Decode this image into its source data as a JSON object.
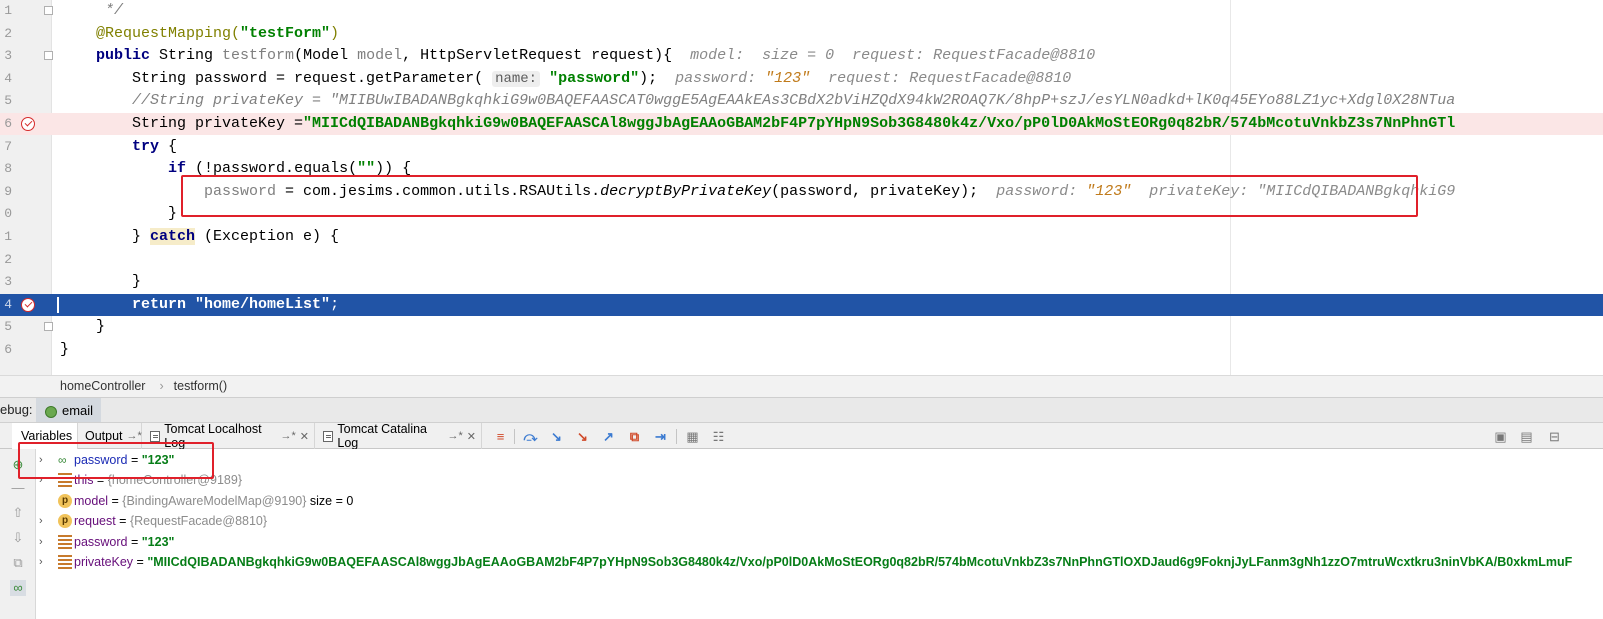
{
  "editor": {
    "lines": [
      {
        "n": "1",
        "parts": [
          {
            "t": "     */",
            "c": "cmt"
          }
        ]
      },
      {
        "n": "2",
        "parts": [
          {
            "t": "    @RequestMapping(",
            "c": "ann"
          },
          {
            "t": "\"testForm\"",
            "c": "str"
          },
          {
            "t": ")",
            "c": "ann"
          }
        ]
      },
      {
        "n": "3",
        "parts": [
          {
            "t": "    ",
            "c": ""
          },
          {
            "t": "public ",
            "c": "kw"
          },
          {
            "t": "String ",
            "c": ""
          },
          {
            "t": "testform",
            "c": "dim"
          },
          {
            "t": "(Model ",
            "c": ""
          },
          {
            "t": "model",
            "c": "dim"
          },
          {
            "t": ", HttpServletRequest request){  ",
            "c": ""
          },
          {
            "t": "model:  size = 0  request: RequestFacade@8810",
            "c": "hint"
          }
        ]
      },
      {
        "n": "4",
        "parts": [
          {
            "t": "        String password = request.getParameter( ",
            "c": ""
          },
          {
            "t": "name:",
            "c": "chip"
          },
          {
            "t": " ",
            "c": ""
          },
          {
            "t": "\"password\"",
            "c": "str"
          },
          {
            "t": ");  ",
            "c": ""
          },
          {
            "t": "password: ",
            "c": "hint"
          },
          {
            "t": "\"123\"",
            "c": "hstr"
          },
          {
            "t": "  request: RequestFacade@8810",
            "c": "hint"
          }
        ]
      },
      {
        "n": "5",
        "parts": [
          {
            "t": "        //String privateKey = \"MIIBUwIBADANBgkqhkiG9w0BAQEFAASCAT0wggE5AgEAAkEAs3CBdX2bViHZQdX94kW2ROAQ7K/8hpP+szJ/esYLN0adkd+lK0q45EYo88LZ1yc+Xdgl0X28NTua",
            "c": "cmt"
          }
        ]
      },
      {
        "n": "6",
        "parts": [
          {
            "t": "        String privateKey =",
            "c": ""
          },
          {
            "t": "\"MIICdQIBADANBgkqhkiG9w0BAQEFAASCAl8wggJbAgEAAoGBAM2bF4P7pYHpN9Sob3G8480k4z/Vxo/pP0lD0AkMoStEORg0q82bR/574bMcotuVnkbZ3s7NnPhnGTl",
            "c": "str"
          }
        ]
      },
      {
        "n": "7",
        "parts": [
          {
            "t": "        ",
            "c": ""
          },
          {
            "t": "try ",
            "c": "kw"
          },
          {
            "t": "{",
            "c": ""
          }
        ]
      },
      {
        "n": "8",
        "parts": [
          {
            "t": "            ",
            "c": ""
          },
          {
            "t": "if ",
            "c": "kw"
          },
          {
            "t": "(!password.equals(",
            "c": ""
          },
          {
            "t": "\"\"",
            "c": "str"
          },
          {
            "t": ")) {",
            "c": ""
          }
        ]
      },
      {
        "n": "9",
        "parts": [
          {
            "t": "                ",
            "c": ""
          },
          {
            "t": "password",
            "c": "dim"
          },
          {
            "t": " = com.jesims.common.utils.RSAUtils.",
            "c": ""
          },
          {
            "t": "decryptByPrivateKey",
            "c": "ital"
          },
          {
            "t": "(password, privateKey);  ",
            "c": ""
          },
          {
            "t": "password: ",
            "c": "hint"
          },
          {
            "t": "\"123\"",
            "c": "hstr"
          },
          {
            "t": "  privateKey: \"MIICdQIBADANBgkqhkiG9",
            "c": "hint"
          }
        ]
      },
      {
        "n": "0",
        "parts": [
          {
            "t": "            }",
            "c": ""
          }
        ]
      },
      {
        "n": "1",
        "parts": [
          {
            "t": "        } ",
            "c": ""
          },
          {
            "t": "catch",
            "c": "kw catch-bg"
          },
          {
            "t": " (Exception e) {",
            "c": ""
          }
        ]
      },
      {
        "n": "2",
        "parts": []
      },
      {
        "n": "3",
        "parts": [
          {
            "t": "        }",
            "c": ""
          }
        ]
      },
      {
        "n": "4",
        "parts": [
          {
            "t": "        ",
            "c": ""
          },
          {
            "t": "return ",
            "c": "kw"
          },
          {
            "t": "\"home/homeList\"",
            "c": "str"
          },
          {
            "t": ";",
            "c": ""
          }
        ]
      },
      {
        "n": "5",
        "parts": [
          {
            "t": "    }",
            "c": ""
          }
        ]
      },
      {
        "n": "6",
        "parts": [
          {
            "t": "}",
            "c": ""
          }
        ]
      }
    ]
  },
  "breadcrumb": {
    "class_name": "homeController",
    "method_name": "testform()"
  },
  "debug": {
    "label": "ebug:",
    "session_name": "email"
  },
  "tabs": [
    {
      "label": "Variables",
      "active": true
    },
    {
      "label": "Output",
      "arrow": "→*"
    },
    {
      "label": "Tomcat Localhost Log",
      "arrow": "→*"
    },
    {
      "label": "Tomcat Catalina Log",
      "arrow": "→*"
    }
  ],
  "icons": {
    "breakpoint": "breakpoint-icon",
    "fold": "fold-icon",
    "bug": "bug-icon",
    "watch": "watch-icon",
    "field": "field-icon",
    "param": "parameter-icon"
  },
  "colors": {
    "current_line": "#2154a6",
    "breakpoint_line": "#fbe6e6",
    "highlight_box": "#e0202a",
    "string": "#008000",
    "keyword": "#000080"
  },
  "variables": [
    {
      "expand": true,
      "icon": "watch",
      "name": "password",
      "eq": " = ",
      "value": "\"123\"",
      "vtype": "str",
      "extra": "",
      "blue": true
    },
    {
      "expand": true,
      "icon": "field",
      "name": "this",
      "eq": " = ",
      "value": "{homeController@9189}",
      "vtype": "obj",
      "extra": ""
    },
    {
      "expand": false,
      "icon": "param",
      "name": "model",
      "eq": " = ",
      "value": "{BindingAwareModelMap@9190}",
      "vtype": "obj",
      "extra": "  size = 0"
    },
    {
      "expand": true,
      "icon": "param",
      "name": "request",
      "eq": " = ",
      "value": "{RequestFacade@8810}",
      "vtype": "obj",
      "extra": ""
    },
    {
      "expand": true,
      "icon": "field",
      "name": "password",
      "eq": " = ",
      "value": "\"123\"",
      "vtype": "str",
      "extra": ""
    },
    {
      "expand": true,
      "icon": "field",
      "name": "privateKey",
      "eq": " = ",
      "value": "\"MIICdQIBADANBgkqhkiG9w0BAQEFAASCAl8wggJbAgEAAoGBAM2bF4P7pYHpN9Sob3G8480k4z/Vxo/pP0lD0AkMoStEORg0q82bR/574bMcotuVnkbZ3s7NnPhnGTlOXDJaud6g9FoknjJyLFanm3gNh1zzO7mtruWcxtkru3ninVbKA/B0xkmLmuF",
      "vtype": "str",
      "extra": ""
    }
  ]
}
